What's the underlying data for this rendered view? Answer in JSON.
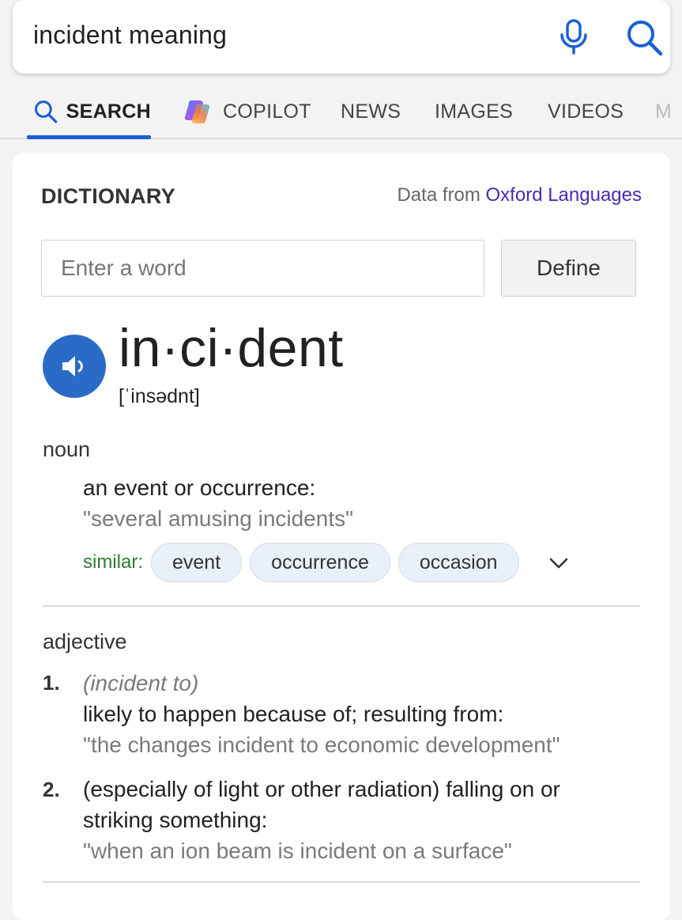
{
  "search": {
    "query": "incident meaning"
  },
  "tabs": [
    {
      "label": "SEARCH"
    },
    {
      "label": "COPILOT"
    },
    {
      "label": "NEWS"
    },
    {
      "label": "IMAGES"
    },
    {
      "label": "VIDEOS"
    },
    {
      "label": "M"
    }
  ],
  "dictionary": {
    "title": "DICTIONARY",
    "source_prefix": "Data from",
    "source_link": "Oxford Languages",
    "input_placeholder": "Enter a word",
    "define_label": "Define",
    "headword": "in·ci·dent",
    "pronunciation": "[ˈinsədnt]",
    "noun": {
      "label": "noun",
      "definition": "an event or occurrence:",
      "example": "\"several amusing incidents\"",
      "similar_label": "similar:",
      "similar": [
        "event",
        "occurrence",
        "occasion"
      ]
    },
    "adjective": {
      "label": "adjective",
      "senses": [
        {
          "num": "1.",
          "qualifier": "(incident to)",
          "definition": "likely to happen because of; resulting from:",
          "example": "\"the changes incident to economic development\""
        },
        {
          "num": "2.",
          "definition_line1": "(especially of light or other radiation) falling on or",
          "definition_line2": "striking something:",
          "example": "\"when an ion beam is incident on a surface\""
        }
      ]
    }
  },
  "colors": {
    "accent": "#1a5fd6",
    "speaker": "#2a6bc7",
    "link": "#4b2bb0",
    "similar": "#2e7d32"
  }
}
